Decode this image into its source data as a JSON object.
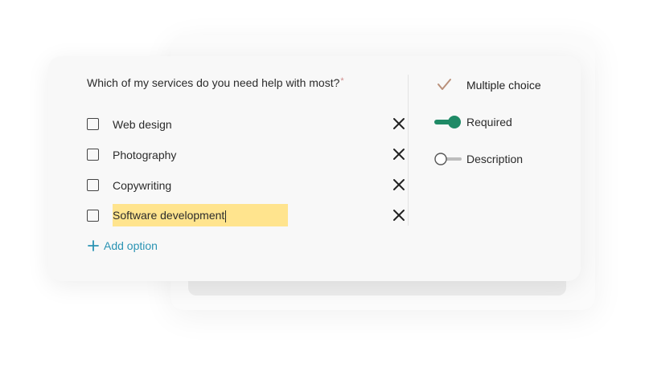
{
  "question": {
    "text": "Which of my services do you need help with most?",
    "required_mark": "*"
  },
  "options": [
    {
      "label": "Web design"
    },
    {
      "label": "Photography"
    },
    {
      "label": "Copywriting"
    },
    {
      "label": "Software development",
      "editing": true
    }
  ],
  "add_option": {
    "label": "Add option"
  },
  "settings": {
    "multiple_choice": {
      "label": "Multiple choice",
      "checked": true
    },
    "required": {
      "label": "Required",
      "on": true
    },
    "description": {
      "label": "Description",
      "on": false
    }
  },
  "colors": {
    "toggle_on": "#1f8a66",
    "accent_link": "#2a93b3",
    "highlight": "#ffe48e",
    "checkmark": "#b9907a"
  }
}
